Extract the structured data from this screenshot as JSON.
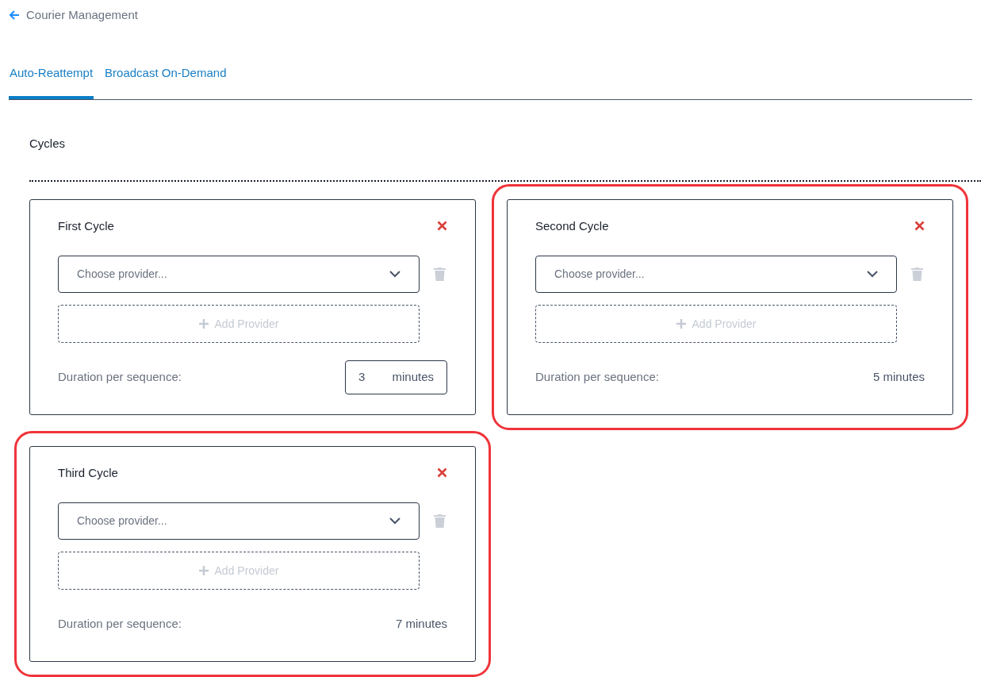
{
  "back_link": {
    "label": "Courier Management"
  },
  "tabs": [
    {
      "label": "Auto-Reattempt",
      "selected": true
    },
    {
      "label": "Broadcast On-Demand",
      "selected": false
    }
  ],
  "section_title": "Cycles",
  "cycles": [
    {
      "title": "First Cycle",
      "provider_placeholder": "Choose provider...",
      "add_label": "Add Provider",
      "duration_label": "Duration per sequence:",
      "duration": {
        "kind": "input",
        "value": "3",
        "unit": "minutes"
      },
      "highlighted": false
    },
    {
      "title": "Second Cycle",
      "provider_placeholder": "Choose provider...",
      "add_label": "Add Provider",
      "duration_label": "Duration per sequence:",
      "duration": {
        "kind": "text",
        "value": "5",
        "unit": "minutes"
      },
      "highlighted": true
    },
    {
      "title": "Third Cycle",
      "provider_placeholder": "Choose provider...",
      "add_label": "Add Provider",
      "duration_label": "Duration per sequence:",
      "duration": {
        "kind": "text",
        "value": "7",
        "unit": "minutes"
      },
      "highlighted": true
    }
  ]
}
